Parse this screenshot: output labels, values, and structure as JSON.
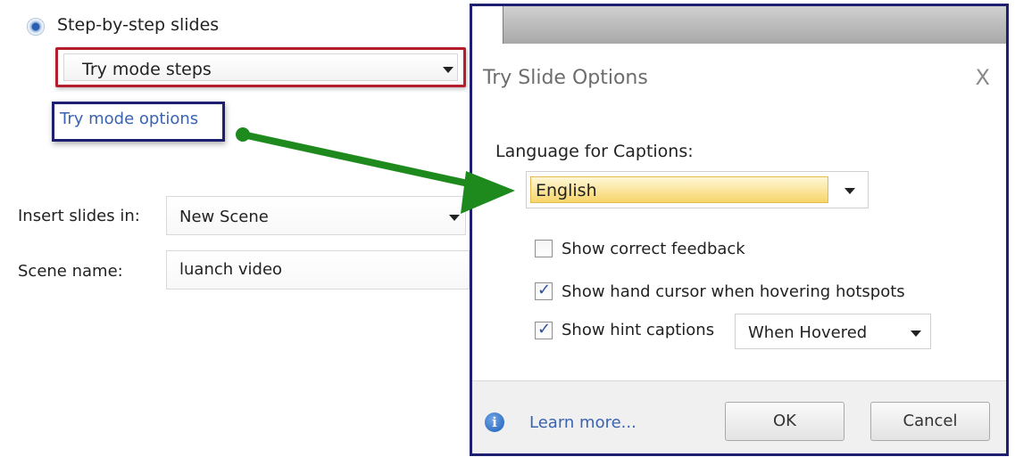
{
  "left_panel": {
    "radio_label": "Step-by-step slides",
    "mode_dropdown": "Try mode steps",
    "options_link": "Try mode options",
    "insert_label": "Insert slides in:",
    "insert_value": "New Scene",
    "scene_label": "Scene name:",
    "scene_value": "luanch video"
  },
  "dialog": {
    "title": "Try Slide Options",
    "close_glyph": "X",
    "language_label": "Language for Captions:",
    "language_value": "English",
    "options": [
      {
        "label": "Show correct feedback",
        "checked": false
      },
      {
        "label": "Show hand cursor when hovering hotspots",
        "checked": true
      },
      {
        "label": "Show hint captions",
        "checked": true
      }
    ],
    "hint_value": "When Hovered",
    "learn_more": "Learn more...",
    "ok_label": "OK",
    "cancel_label": "Cancel"
  },
  "colors": {
    "highlight_red": "#b41e2b",
    "highlight_navy": "#1f1f72",
    "arrow_green": "#1e8a1e",
    "link_blue": "#3a63b0"
  }
}
